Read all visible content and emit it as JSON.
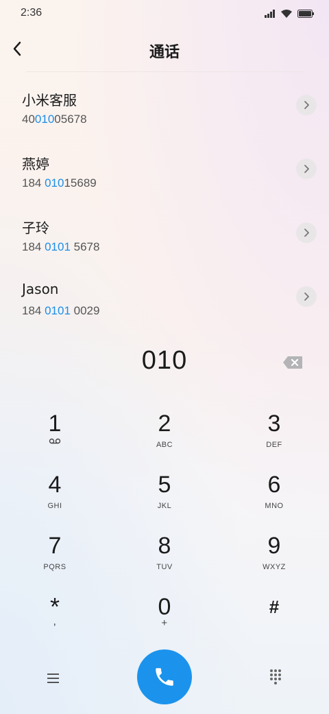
{
  "status_bar": {
    "time": "2:36"
  },
  "header": {
    "title": "通话"
  },
  "contacts": [
    {
      "name": "小米客服",
      "number_pre": "40",
      "number_hl": "010",
      "number_post": "05678"
    },
    {
      "name": "燕婷",
      "number_pre": "184 ",
      "number_hl": "010",
      "number_post": "15689"
    },
    {
      "name": "子玲",
      "number_pre": "184 ",
      "number_hl": "0101",
      "number_post": " 5678"
    },
    {
      "name": "Jason",
      "number_pre": "184 ",
      "number_hl": "0101",
      "number_post": " 0029"
    }
  ],
  "dialer": {
    "input": "010"
  },
  "keypad": [
    {
      "digit": "1",
      "letters": "",
      "sub_icon": "voicemail-icon"
    },
    {
      "digit": "2",
      "letters": "ABC"
    },
    {
      "digit": "3",
      "letters": "DEF"
    },
    {
      "digit": "4",
      "letters": "GHI"
    },
    {
      "digit": "5",
      "letters": "JKL"
    },
    {
      "digit": "6",
      "letters": "MNO"
    },
    {
      "digit": "7",
      "letters": "PQRS"
    },
    {
      "digit": "8",
      "letters": "TUV"
    },
    {
      "digit": "9",
      "letters": "WXYZ"
    },
    {
      "digit": "*",
      "letters": ","
    },
    {
      "digit": "0",
      "letters": "+"
    },
    {
      "digit": "#",
      "letters": ""
    }
  ],
  "colors": {
    "accent": "#1b93ec",
    "highlight": "#1b8ee8"
  },
  "icons": {
    "back": "chevron-left-icon",
    "backspace": "backspace-icon",
    "menu": "menu-icon",
    "call": "phone-icon",
    "dialpad": "dialpad-icon"
  }
}
